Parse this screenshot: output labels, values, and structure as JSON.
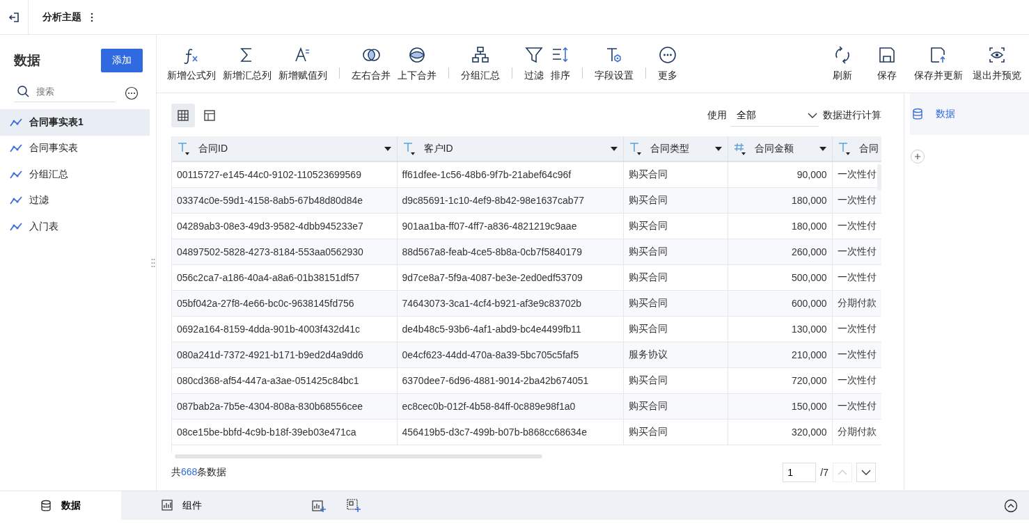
{
  "topbar": {
    "title": "分析主题"
  },
  "sidebar": {
    "heading": "数据",
    "add_button": "添加",
    "search": {
      "placeholder": "搜索"
    },
    "items": [
      {
        "label": "合同事实表1",
        "selected": true
      },
      {
        "label": "合同事实表",
        "selected": false
      },
      {
        "label": "分组汇总",
        "selected": false
      },
      {
        "label": "过滤",
        "selected": false
      },
      {
        "label": "入门表",
        "selected": false
      }
    ]
  },
  "toolbar": {
    "groups": [
      [
        {
          "label": "新增公式列"
        },
        {
          "label": "新增汇总列"
        },
        {
          "label": "新增赋值列"
        }
      ],
      [
        {
          "label": "左右合并"
        },
        {
          "label": "上下合并"
        }
      ],
      [
        {
          "label": "分组汇总"
        }
      ],
      [
        {
          "label": "过滤"
        },
        {
          "label": "排序"
        }
      ],
      [
        {
          "label": "字段设置"
        }
      ],
      [
        {
          "label": "更多"
        }
      ]
    ],
    "actions": [
      {
        "label": "刷新"
      },
      {
        "label": "保存"
      },
      {
        "label": "保存并更新"
      },
      {
        "label": "退出并预览"
      }
    ]
  },
  "view_toggle": [
    {
      "selected": true
    },
    {
      "selected": false
    }
  ],
  "calc_scope": {
    "prefix": "使用",
    "value": "全部",
    "suffix": "数据进行计算"
  },
  "table": {
    "columns": [
      {
        "label": "合同ID",
        "kind": "text"
      },
      {
        "label": "客户ID",
        "kind": "text"
      },
      {
        "label": "合同类型",
        "kind": "text"
      },
      {
        "label": "合同金额",
        "kind": "number"
      },
      {
        "label": "合同",
        "kind": "text"
      }
    ],
    "rows": [
      [
        "00115727-e145-44c0-9102-110523699569",
        "ff61dfee-1c56-48b6-9f7b-21abef64c96f",
        "购买合同",
        "90,000",
        "一次性付"
      ],
      [
        "03374c0e-59d1-4158-8ab5-67b48d80d84e",
        "d9c85691-1c10-4ef9-8b42-98e1637cab77",
        "购买合同",
        "180,000",
        "一次性付"
      ],
      [
        "04289ab3-08e3-49d3-9582-4dbb945233e7",
        "901aa1ba-ff07-4ff7-a836-4821219c9aae",
        "购买合同",
        "180,000",
        "一次性付"
      ],
      [
        "04897502-5828-4273-8184-553aa0562930",
        "88d567a8-feab-4ce5-8b8a-0cb7f5840179",
        "购买合同",
        "260,000",
        "一次性付"
      ],
      [
        "056c2ca7-a186-40a4-a8a6-01b38151df57",
        "9d7ce8a7-5f9a-4087-be3e-2ed0edf53709",
        "购买合同",
        "500,000",
        "一次性付"
      ],
      [
        "05bf042a-27f8-4e66-bc0c-9638145fd756",
        "74643073-3ca1-4cf4-b921-af3e9c83702b",
        "购买合同",
        "600,000",
        "分期付款"
      ],
      [
        "0692a164-8159-4dda-901b-4003f432d41c",
        "de4b48c5-93b6-4af1-abd9-bc4e4499fb11",
        "购买合同",
        "130,000",
        "一次性付"
      ],
      [
        "080a241d-7372-4921-b171-b9ed2d4a9dd6",
        "0e4cf623-44dd-470a-8a39-5bc705c5faf5",
        "服务协议",
        "210,000",
        "一次性付"
      ],
      [
        "080cd368-af54-447a-a3ae-051425c84bc1",
        "6370dee7-6d96-4881-9014-2ba42b674051",
        "购买合同",
        "720,000",
        "一次性付"
      ],
      [
        "087bab2a-7b5e-4304-808a-830b68556cee",
        "ec8cec0b-012f-4b58-84ff-0c889e98f1a0",
        "购买合同",
        "150,000",
        "一次性付"
      ],
      [
        "08ce15be-bbfd-4c9b-b18f-39eb03e471ca",
        "456419b5-d3c7-499b-b07b-b868cc68634e",
        "购买合同",
        "320,000",
        "分期付款"
      ]
    ]
  },
  "footer": {
    "prefix": "共",
    "count": "668",
    "suffix": "条数据",
    "page": "1",
    "pages": "/7"
  },
  "right_panel": {
    "item": "数据"
  },
  "bottom_tabs": [
    {
      "label": "数据",
      "selected": true
    },
    {
      "label": "组件",
      "selected": false
    }
  ]
}
